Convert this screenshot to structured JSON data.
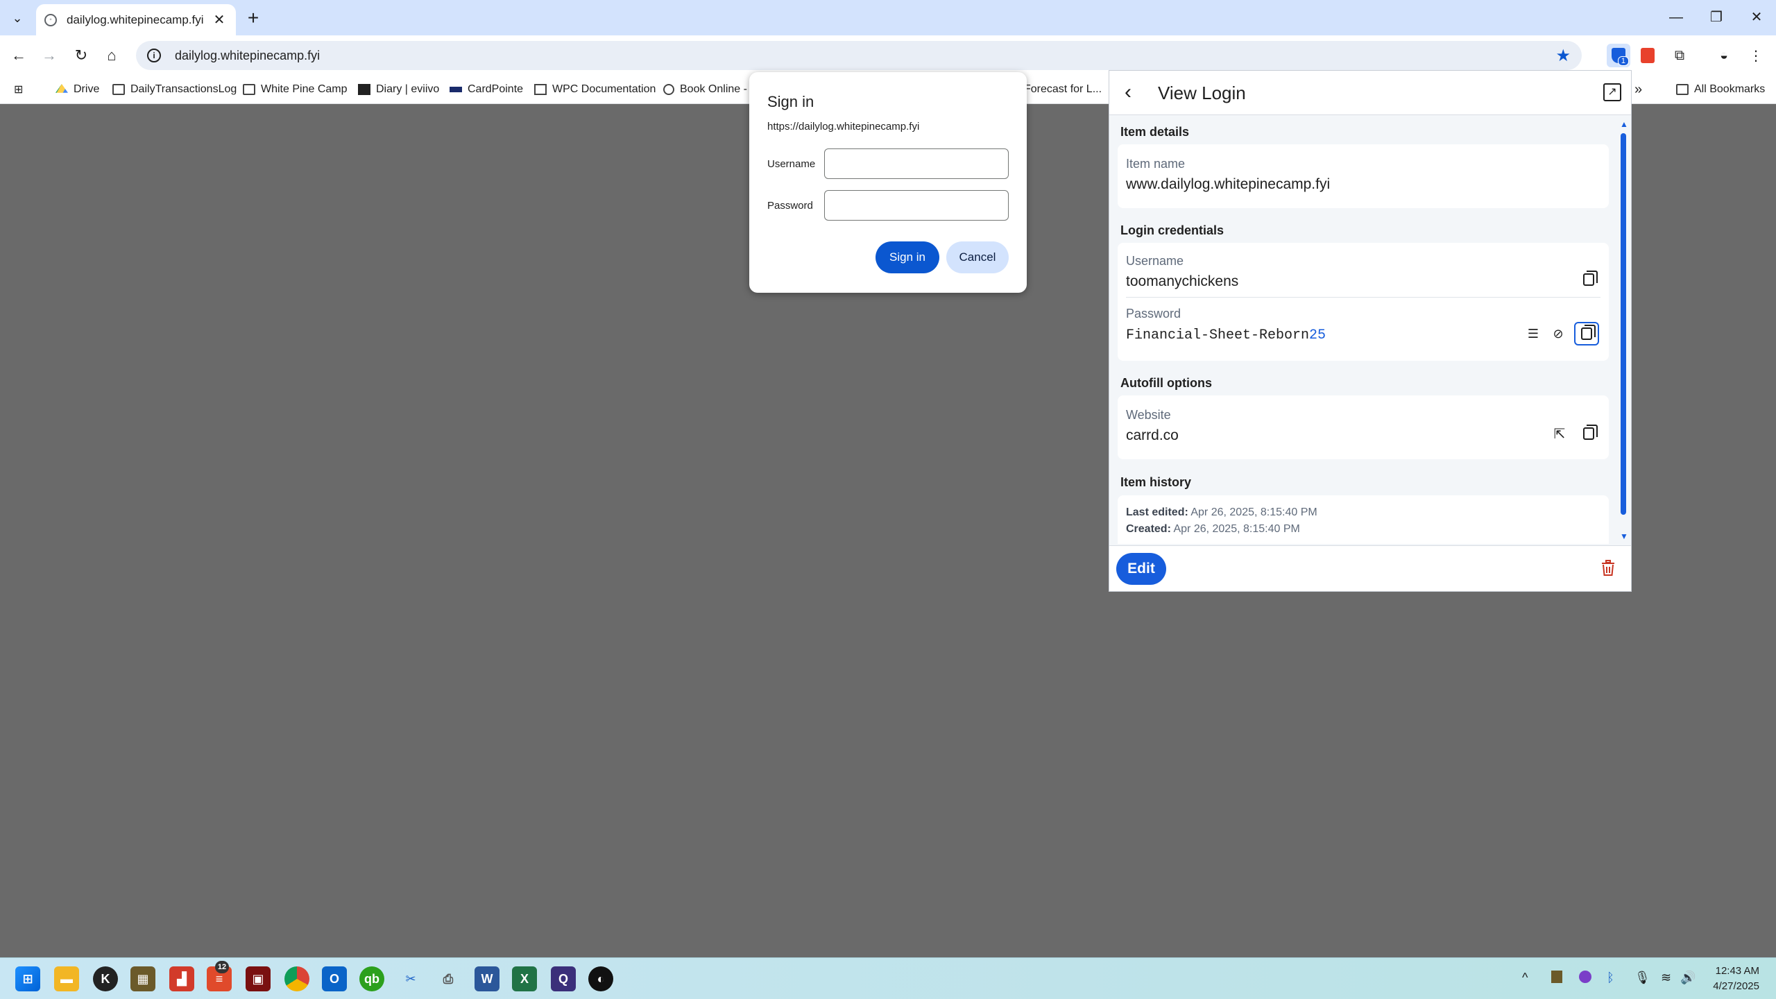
{
  "browser": {
    "tab_title": "dailylog.whitepinecamp.fyi",
    "url": "dailylog.whitepinecamp.fyi",
    "ext_badge": "1",
    "bookmarks": [
      "Drive",
      "DailyTransactionsLog",
      "White Pine Camp",
      "Diary | eviivo",
      "CardPointe",
      "WPC Documentation",
      "Book Online -",
      "Forecast for L..."
    ],
    "all_bookmarks": "All Bookmarks",
    "overflow": "»"
  },
  "signin": {
    "title": "Sign in",
    "origin": "https://dailylog.whitepinecamp.fyi",
    "username_label": "Username",
    "password_label": "Password",
    "signin_button": "Sign in",
    "cancel_button": "Cancel"
  },
  "bitwarden": {
    "title": "View Login",
    "item_details": "Item details",
    "item_name_label": "Item name",
    "item_name": "www.dailylog.whitepinecamp.fyi",
    "login_credentials": "Login credentials",
    "username_label": "Username",
    "username": "toomanychickens",
    "password_label": "Password",
    "password_text": "Financial-Sheet-Reborn",
    "password_digits": "25",
    "autofill_options": "Autofill options",
    "website_label": "Website",
    "website": "carrd.co",
    "item_history": "Item history",
    "last_edited_label": "Last edited:",
    "last_edited": "Apr 26, 2025, 8:15:40 PM",
    "created_label": "Created:",
    "created": "Apr 26, 2025, 8:15:40 PM",
    "edit_button": "Edit"
  },
  "taskbar": {
    "time": "12:43 AM",
    "date": "4/27/2025",
    "badge": "12"
  },
  "colors": {
    "accent": "#175ddc",
    "chrome_blue": "#0b57d0",
    "delete_red": "#c83522"
  }
}
